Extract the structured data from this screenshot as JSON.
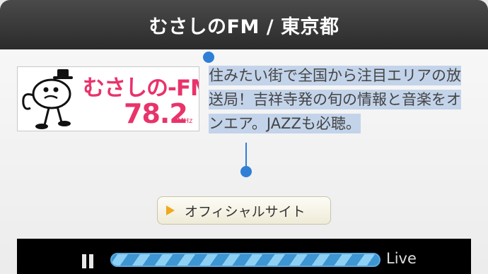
{
  "header": {
    "title": "むさしのFM / 東京都"
  },
  "logo": {
    "name_text": "むさしの-FM",
    "frequency": "78.2",
    "unit": "MHz",
    "brand_color": "#e8336b"
  },
  "description": {
    "text": "住みたい街で全国から注目エリアの放送局！吉祥寺発の旬の情報と音楽をオンエア。JAZZも必聴。",
    "selection_color": "#c3d4ea",
    "handle_color": "#2f7fd6"
  },
  "actions": {
    "official_site_label": "オフィシャルサイト",
    "official_site_icon": "play-triangle-icon"
  },
  "player": {
    "pause_icon": "pause-icon",
    "status_label": "Live",
    "progress_fraction": 1.0
  }
}
